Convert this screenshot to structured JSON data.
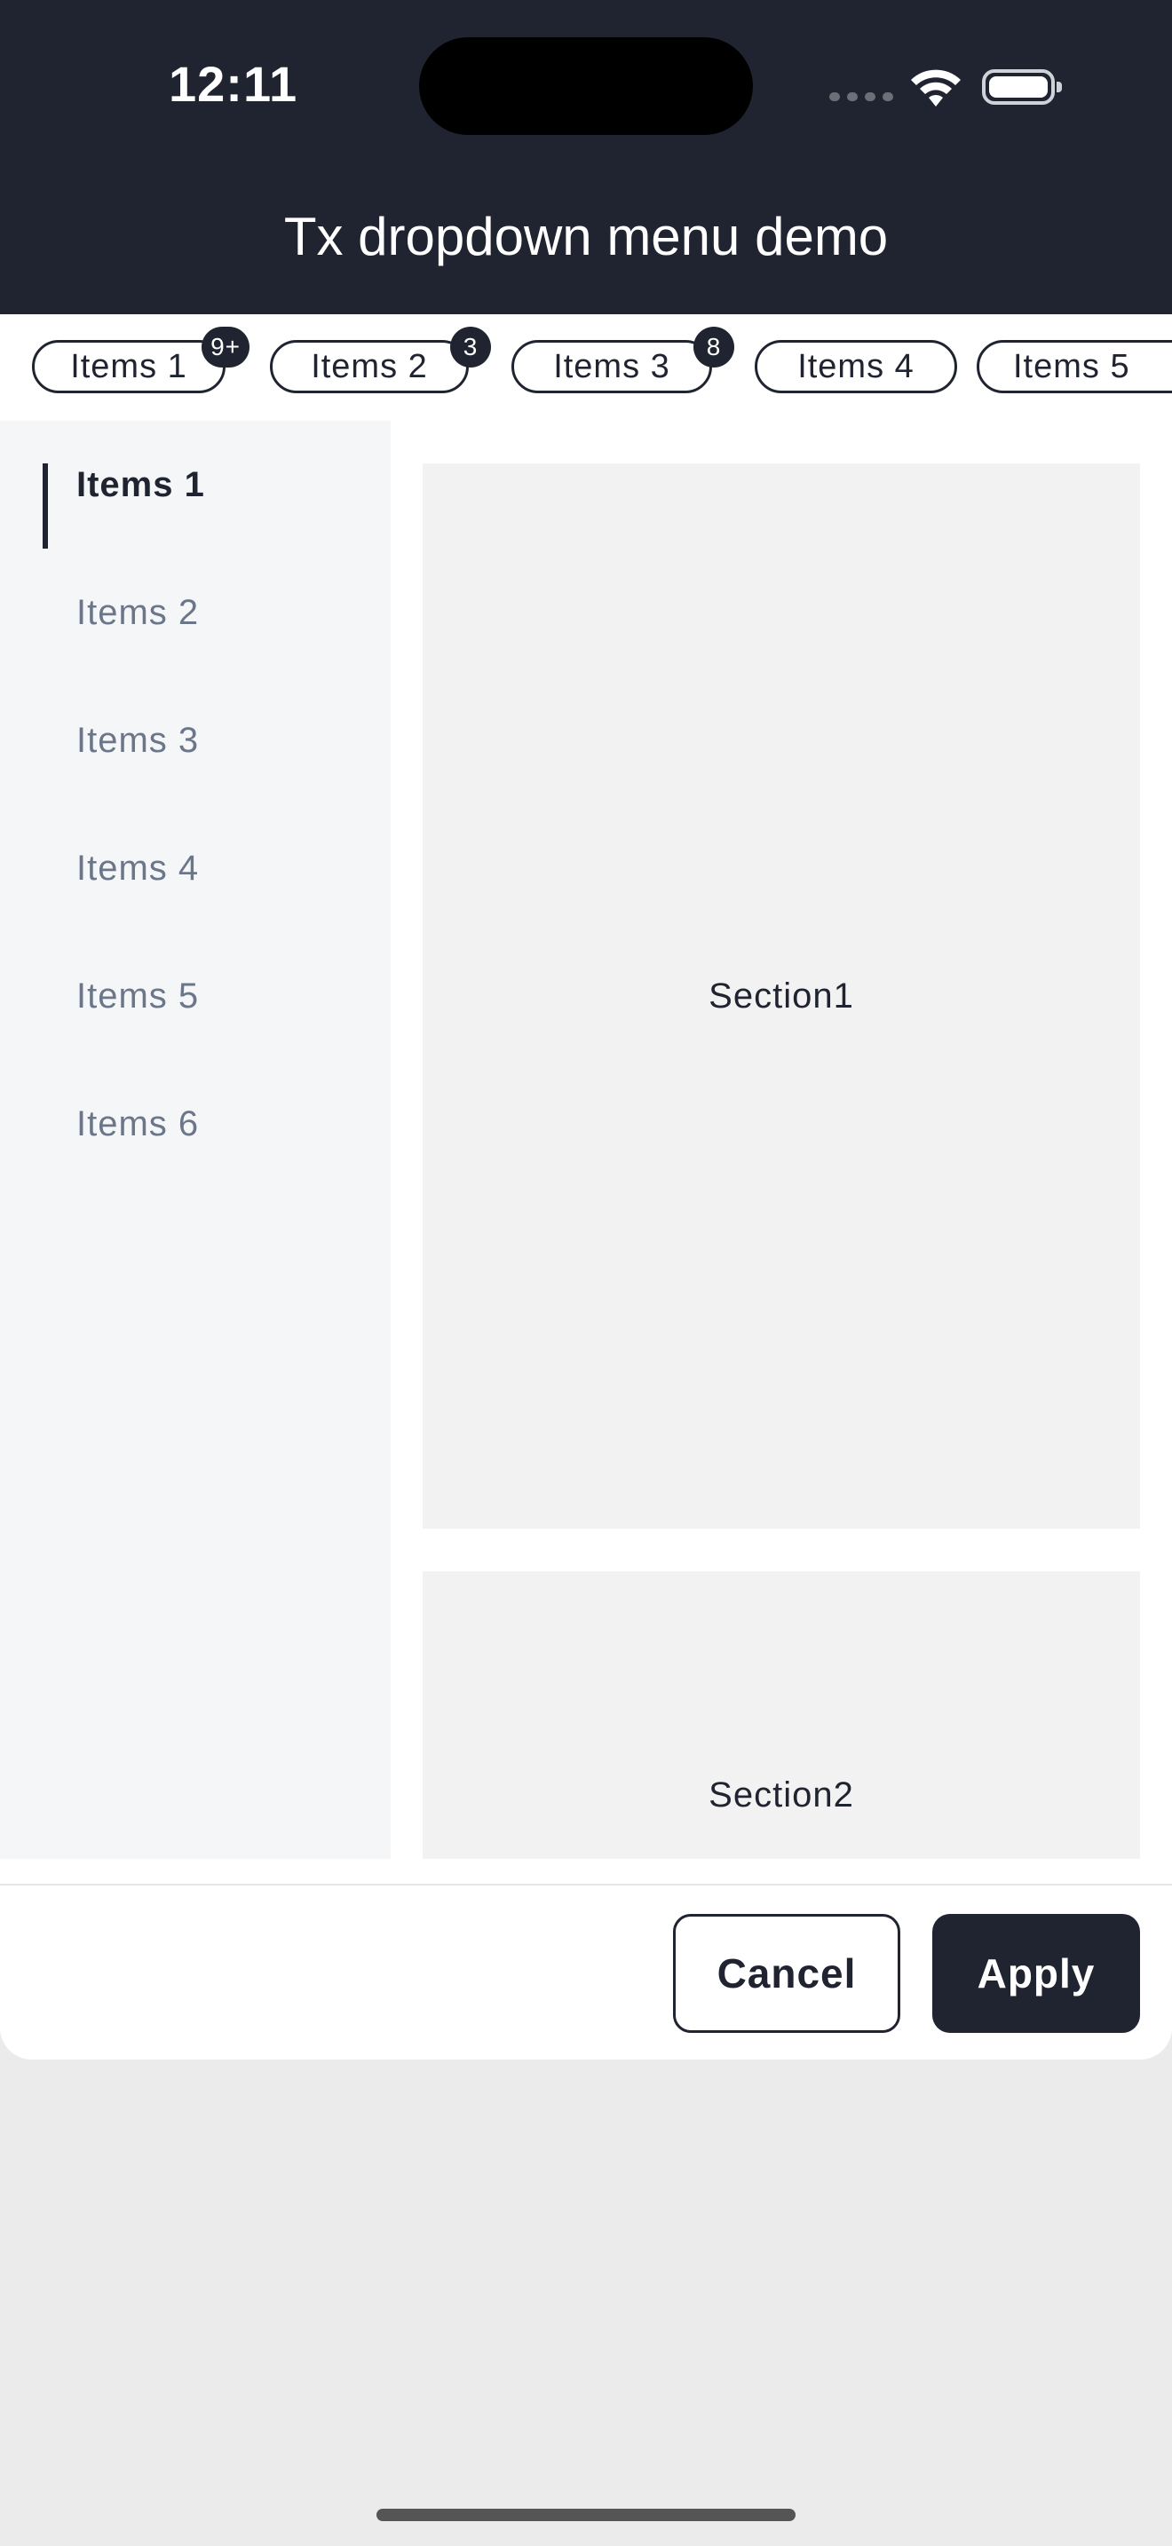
{
  "status_bar": {
    "time": "12:11"
  },
  "header": {
    "title": "Tx dropdown menu demo"
  },
  "tabs": [
    {
      "label": "Items 1",
      "badge": "9+"
    },
    {
      "label": "Items 2",
      "badge": "3"
    },
    {
      "label": "Items 3",
      "badge": "8"
    },
    {
      "label": "Items 4",
      "badge": ""
    },
    {
      "label": "Items 5",
      "badge": ""
    }
  ],
  "sidebar": {
    "items": [
      {
        "label": "Items 1",
        "active": true
      },
      {
        "label": "Items 2",
        "active": false
      },
      {
        "label": "Items 3",
        "active": false
      },
      {
        "label": "Items 4",
        "active": false
      },
      {
        "label": "Items 5",
        "active": false
      },
      {
        "label": "Items 6",
        "active": false
      }
    ]
  },
  "sections": [
    {
      "label": "Section1"
    },
    {
      "label": "Section2"
    }
  ],
  "footer": {
    "cancel_label": "Cancel",
    "apply_label": "Apply"
  },
  "colors": {
    "header_bg": "#1f2430",
    "accent": "#1f2430",
    "sidebar_bg": "#f4f6f8",
    "inactive_text": "#6b7788",
    "section_bg": "#f2f2f2",
    "backdrop": "#ebebeb"
  }
}
